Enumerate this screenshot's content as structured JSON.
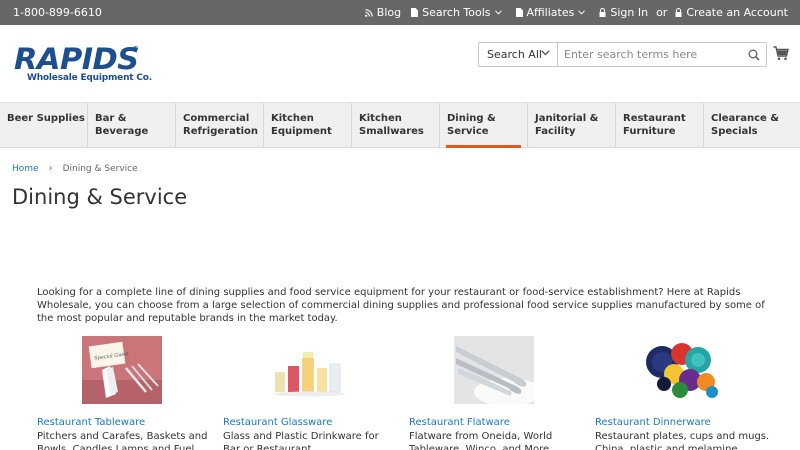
{
  "topbar": {
    "phone": "1-800-899-6610",
    "links": [
      {
        "label": "Blog",
        "icon": "rss-icon"
      },
      {
        "label": "Search Tools",
        "icon": "document-icon",
        "dropdown": true
      },
      {
        "label": "Affiliates",
        "icon": "document-icon",
        "dropdown": true
      },
      {
        "label": "Sign In",
        "icon": "lock-icon"
      },
      {
        "label": "Create an Account",
        "icon": "lock-icon"
      }
    ],
    "or": "or"
  },
  "logo": {
    "main": "RAPIDS",
    "reg": "®",
    "sub": "Wholesale Equipment Co."
  },
  "search": {
    "select_label": "Search All",
    "placeholder": "Enter search terms here"
  },
  "nav": {
    "items": [
      {
        "label": "Beer Supplies",
        "active": false
      },
      {
        "label": "Bar & Beverage",
        "active": false
      },
      {
        "label": "Commercial Refrigeration",
        "active": false
      },
      {
        "label": "Kitchen Equipment",
        "active": false
      },
      {
        "label": "Kitchen Smallwares",
        "active": false
      },
      {
        "label": "Dining & Service",
        "active": true
      },
      {
        "label": "Janitorial & Facility",
        "active": false
      },
      {
        "label": "Restaurant Furniture",
        "active": false
      },
      {
        "label": "Clearance & Specials",
        "active": false
      }
    ]
  },
  "breadcrumb": {
    "home": "Home",
    "separator": "›",
    "current": "Dining & Service"
  },
  "page_title": "Dining & Service",
  "intro": "Looking for a complete line of dining supplies and food service equipment for your restaurant or food-service establishment? Here at Rapids Wholesale, you can choose from a large selection of commercial dining supplies and professional food service supplies manufactured by some of the most popular and reputable brands in the market today.",
  "categories": [
    {
      "title": "Restaurant Tableware",
      "desc": "Pitchers and Carafes, Baskets and Bowls, Candles Lamps and Fuel Cells",
      "thumb": "tableware-thumb"
    },
    {
      "title": "Restaurant Glassware",
      "desc": "Glass and Plastic Drinkware for Bar or Restaurant",
      "thumb": "glassware-thumb"
    },
    {
      "title": "Restaurant Flatware",
      "desc": "Flatware from Oneida, World Tableware, Winco, and More",
      "thumb": "flatware-thumb"
    },
    {
      "title": "Restaurant Dinnerware",
      "desc": "Restaurant plates, cups and mugs. China, plastic and melamine",
      "thumb": "dinnerware-thumb"
    }
  ],
  "colors": {
    "topbar": "#666866",
    "accent": "#e4571d",
    "link": "#1979c3",
    "logo": "#1d4e8f",
    "nav_bg": "#f0f0f0"
  }
}
